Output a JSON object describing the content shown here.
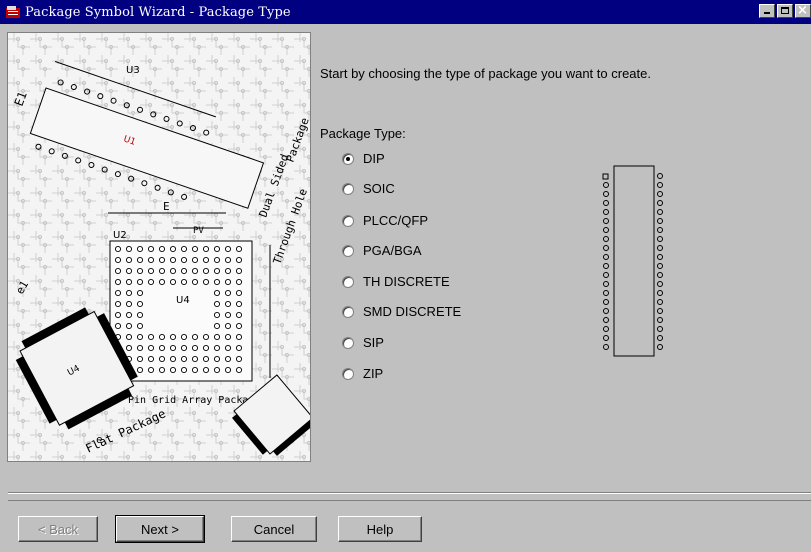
{
  "window": {
    "title": "Package Symbol Wizard - Package Type",
    "title_bar_color": "#000080",
    "controls": [
      "minimize-icon",
      "maximize-icon",
      "close-icon"
    ]
  },
  "illustration": {
    "labels": {
      "u1": "U1",
      "u2": "U2",
      "u3": "U3",
      "u4": "U4",
      "e": "E",
      "e1": "E1",
      "e_small": "e",
      "e1_small": "e1",
      "pv": "PV",
      "dual": "Dual Sided",
      "through": "Through Hole",
      "package": "Package",
      "pga": "Pin Grid Array Package",
      "flat": "Flat Package"
    }
  },
  "instruction": "Start by choosing the type of package you want to create.",
  "package_type": {
    "label": "Package Type:",
    "selected": "DIP",
    "options": [
      "DIP",
      "SOIC",
      "PLCC/QFP",
      "PGA/BGA",
      "TH DISCRETE",
      "SMD DISCRETE",
      "SIP",
      "ZIP"
    ]
  },
  "buttons": {
    "back": "< Back",
    "next": "Next >",
    "cancel": "Cancel",
    "help": "Help"
  }
}
